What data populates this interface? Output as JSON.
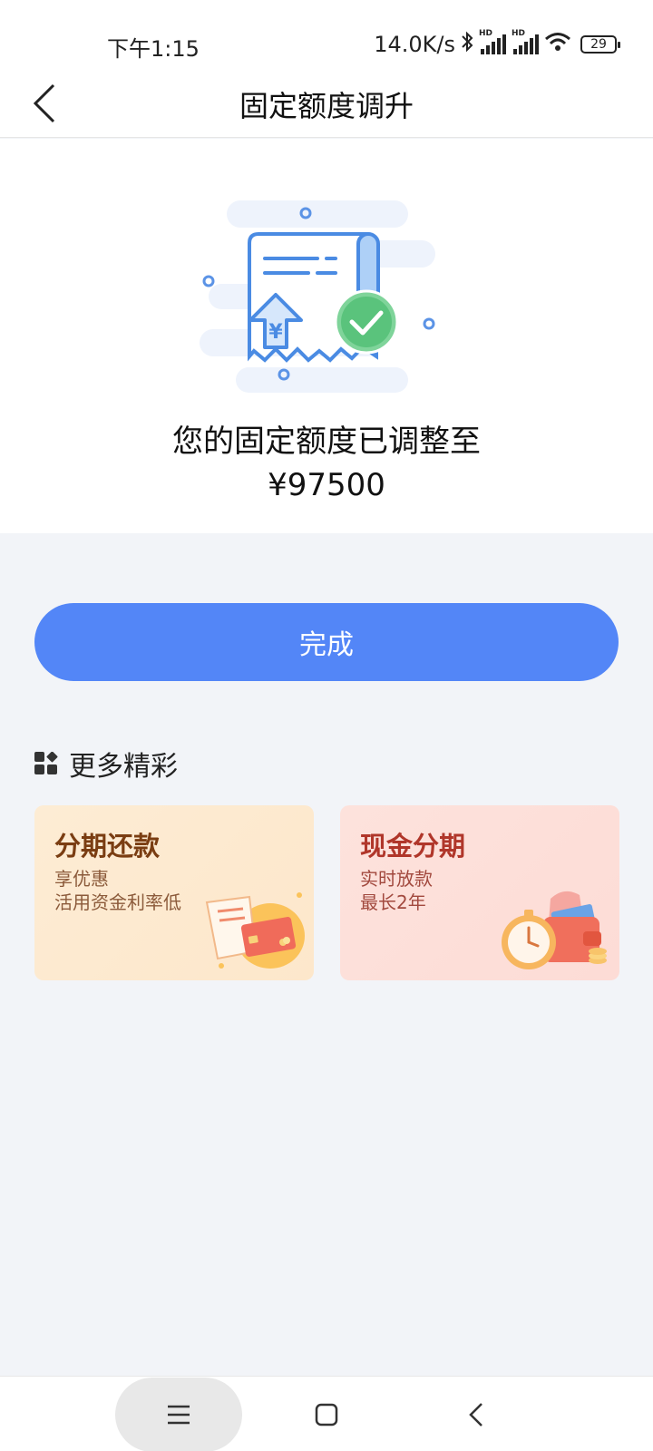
{
  "status_bar": {
    "time": "下午1:15",
    "net_speed": "14.0K/s",
    "signal_label": "HD",
    "battery": "29",
    "icons": [
      "bluetooth-icon",
      "signal-icon",
      "signal-icon",
      "wifi-icon",
      "battery-icon"
    ]
  },
  "nav": {
    "title": "固定额度调升",
    "back_icon": "chevron-left-icon"
  },
  "result": {
    "icon": "receipt-success-icon",
    "message": "您的固定额度已调整至",
    "amount": "¥97500"
  },
  "done_button": {
    "label": "完成"
  },
  "more": {
    "icon": "apps-icon",
    "title": "更多精彩",
    "cards": [
      {
        "title": "分期还款",
        "lines": [
          "享优惠",
          "活用资金利率低"
        ],
        "icon": "bill-card-icon"
      },
      {
        "title": "现金分期",
        "lines": [
          "实时放款",
          "最长2年"
        ],
        "icon": "wallet-clock-icon"
      }
    ]
  },
  "system_nav": {
    "icons": [
      "menu-icon",
      "home-icon",
      "back-icon"
    ]
  },
  "colors": {
    "accent": "#5386f7",
    "page_bg": "#f2f4f8",
    "card1_title": "#7a3d12",
    "card2_title": "#b0362a"
  }
}
